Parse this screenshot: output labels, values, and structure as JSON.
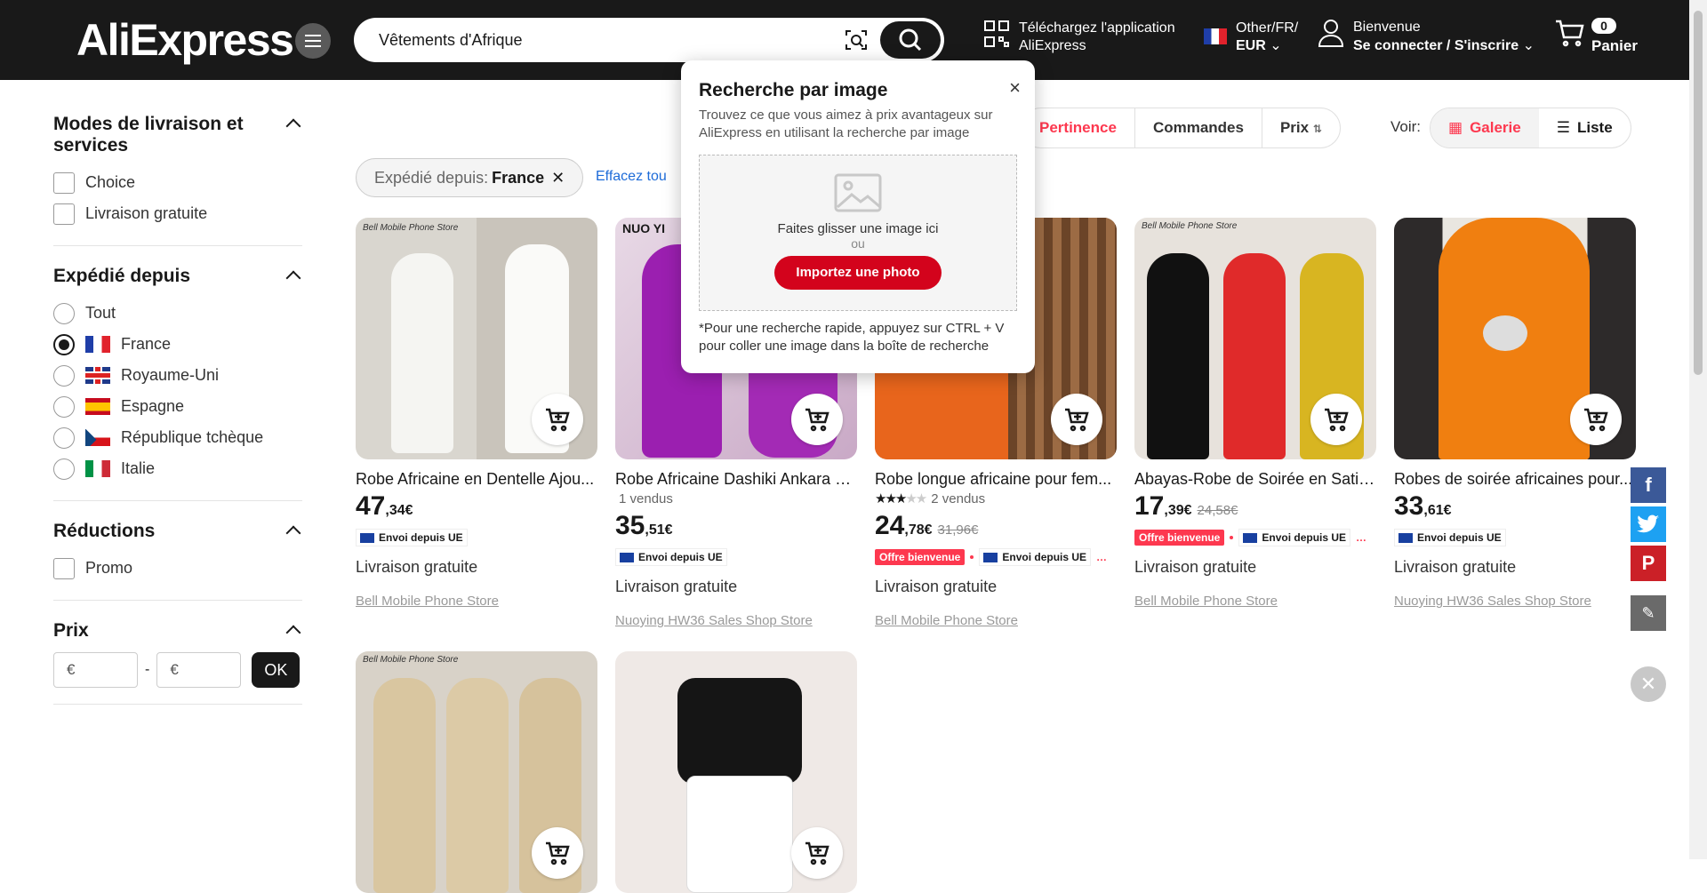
{
  "header": {
    "logo": "AliExpress",
    "search_value": "Vêtements d'Afrique",
    "app_line1": "Téléchargez l'application",
    "app_line2": "AliExpress",
    "locale_line1": "Other/FR/",
    "locale_line2": "EUR",
    "account_line1": "Bienvenue",
    "account_line2": "Se connecter / S'inscrire",
    "cart_count": "0",
    "cart_label": "Panier"
  },
  "sidebar": {
    "delivery": {
      "title": "Modes de livraison et services",
      "options": [
        "Choice",
        "Livraison gratuite"
      ]
    },
    "ship_from": {
      "title": "Expédié depuis",
      "options": [
        "Tout",
        "France",
        "Royaume-Uni",
        "Espagne",
        "République tchèque",
        "Italie"
      ],
      "selected": "France"
    },
    "discounts": {
      "title": "Réductions",
      "options": [
        "Promo"
      ]
    },
    "price": {
      "title": "Prix",
      "min_placeholder": "€",
      "max_placeholder": "€",
      "separator": "-",
      "ok_label": "OK"
    }
  },
  "toolbar": {
    "sort": [
      "Pertinence",
      "Commandes",
      "Prix"
    ],
    "view_label": "Voir:",
    "views": [
      "Galerie",
      "Liste"
    ],
    "chip_prefix": "Expédié depuis:",
    "chip_value": "France",
    "clear_all": "Effacez tou"
  },
  "products": [
    {
      "title": "Robe Africaine en Dentelle Ajou...",
      "sold": "",
      "rating": "",
      "price_int": "47",
      "price_dec": ",34€",
      "old_price": "",
      "badge_red": "",
      "badge_eu": "Envoi depuis UE",
      "shipping": "Livraison gratuite",
      "store": "Bell Mobile Phone Store"
    },
    {
      "title": "Robe Africaine Dashiki Ankara à...",
      "sold": "1 vendus",
      "rating": "",
      "price_int": "35",
      "price_dec": ",51€",
      "old_price": "",
      "badge_red": "",
      "badge_eu": "Envoi depuis UE",
      "shipping": "Livraison gratuite",
      "store": "Nuoying HW36 Sales Shop Store"
    },
    {
      "title": "Robe longue africaine pour fem...",
      "sold": "2 vendus",
      "rating": "3.5",
      "price_int": "24",
      "price_dec": ",78€",
      "old_price": "31,96€",
      "badge_red": "Offre bienvenue",
      "badge_eu": "Envoi depuis UE",
      "shipping": "Livraison gratuite",
      "store": "Bell Mobile Phone Store"
    },
    {
      "title": "Abayas-Robe de Soirée en Satin...",
      "sold": "",
      "rating": "",
      "price_int": "17",
      "price_dec": ",39€",
      "old_price": "24,58€",
      "badge_red": "Offre bienvenue",
      "badge_eu": "Envoi depuis UE",
      "shipping": "Livraison gratuite",
      "store": "Bell Mobile Phone Store"
    },
    {
      "title": "Robes de soirée africaines pour...",
      "sold": "",
      "rating": "",
      "price_int": "33",
      "price_dec": ",61€",
      "old_price": "",
      "badge_red": "",
      "badge_eu": "Envoi depuis UE",
      "shipping": "Livraison gratuite",
      "store": "Nuoying HW36 Sales Shop Store"
    }
  ],
  "image_overlay_text": [
    "Bell Mobile Phone Store",
    "NUO YI"
  ],
  "popup": {
    "title": "Recherche par image",
    "desc": "Trouvez ce que vous aimez à prix avantageux sur AliExpress en utilisant la recherche par image",
    "drop_text": "Faites glisser une image ici",
    "or": "ou",
    "upload_label": "Importez une photo",
    "tip": "*Pour une recherche rapide, appuyez sur CTRL + V pour coller une image dans la boîte de recherche",
    "close": "×"
  },
  "colors": {
    "accent": "#fd384f",
    "header_bg": "#191919",
    "upload_button": "#d3031c",
    "link": "#1d6bd8",
    "facebook": "#3b5998",
    "twitter": "#1da1f2",
    "pinterest": "#cb2027"
  }
}
